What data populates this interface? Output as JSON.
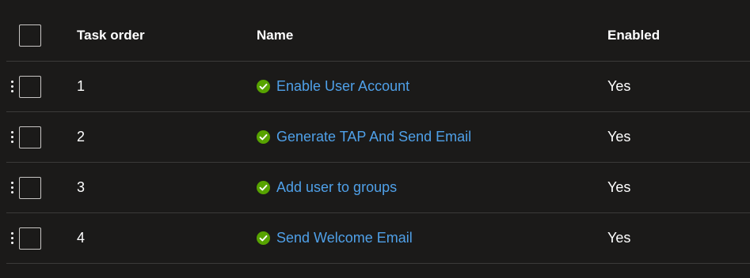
{
  "columns": {
    "order": "Task order",
    "name": "Name",
    "enabled": "Enabled"
  },
  "rows": [
    {
      "order": "1",
      "name": "Enable User Account",
      "enabled": "Yes"
    },
    {
      "order": "2",
      "name": "Generate TAP And Send Email",
      "enabled": "Yes"
    },
    {
      "order": "3",
      "name": "Add user to groups",
      "enabled": "Yes"
    },
    {
      "order": "4",
      "name": "Send Welcome Email",
      "enabled": "Yes"
    }
  ],
  "colors": {
    "background": "#1b1a19",
    "link": "#4fa0e8",
    "success": "#57a300",
    "divider": "#3b3a39"
  },
  "icons": {
    "status": "check-circle-icon",
    "drag": "drag-handle-icon"
  }
}
